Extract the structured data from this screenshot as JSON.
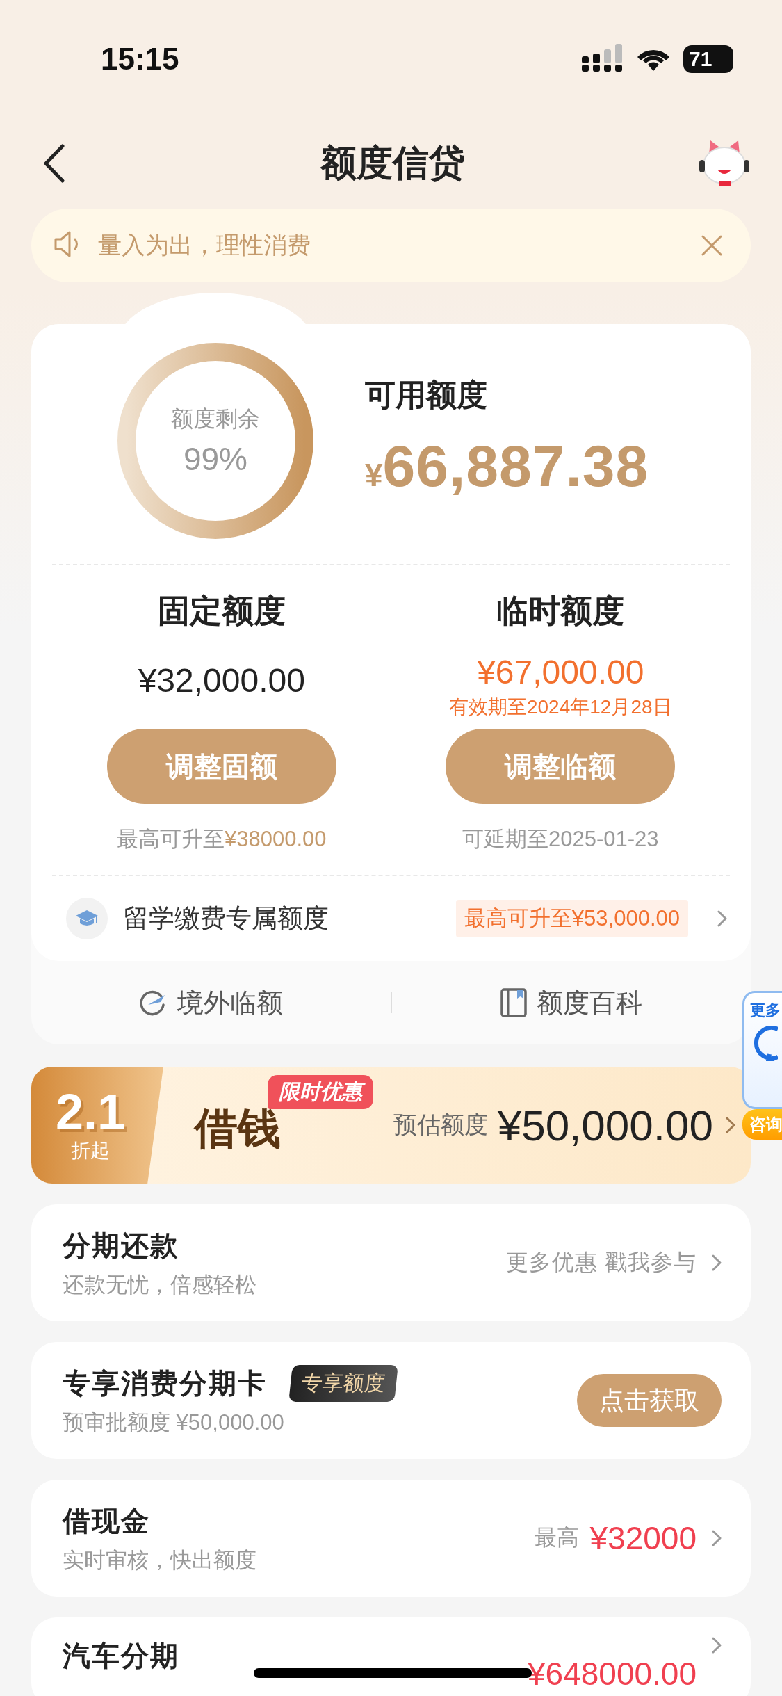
{
  "status_bar": {
    "time": "15:15",
    "battery": "71"
  },
  "nav": {
    "title": "额度信贷"
  },
  "notice": {
    "text": "量入为出，理性消费"
  },
  "quota": {
    "ring_label": "额度剩余",
    "ring_percent": "99%",
    "available_label": "可用额度",
    "available_currency": "¥",
    "available_amount": "66,887.38",
    "columns": [
      {
        "kind": "fixed",
        "title": "固定额度",
        "amount": "¥32,000.00",
        "button": "调整固额",
        "note": "最高可升至",
        "note_value": "¥38000.00"
      },
      {
        "kind": "temporary",
        "title": "临时额度",
        "amount": "¥67,000.00",
        "validity": "有效期至2024年12月28日",
        "button": "调整临额",
        "note": "可延期至2025-01-23"
      }
    ],
    "study": {
      "label": "留学缴费专属额度",
      "badge": "最高可升至¥53,000.00"
    },
    "links": [
      {
        "kind": "overseas",
        "label": "境外临额"
      },
      {
        "kind": "wiki",
        "label": "额度百科"
      }
    ]
  },
  "promo": {
    "discount": "2.1",
    "discount_suffix": "折起",
    "title": "借钱",
    "tag": "限时优惠",
    "label": "预估额度",
    "amount": "¥50,000.00"
  },
  "products": [
    {
      "kind": "link",
      "title": "分期还款",
      "subtitle": "还款无忧，倍感轻松",
      "action": "更多优惠 戳我参与"
    },
    {
      "kind": "button",
      "title": "专享消费分期卡",
      "tag": "专享额度",
      "subtitle": "预审批额度 ¥50,000.00",
      "action": "点击获取"
    },
    {
      "kind": "max",
      "title": "借现金",
      "subtitle": "实时审核，快出额度",
      "prefix": "最高",
      "action": "¥32000"
    },
    {
      "kind": "max",
      "title": "汽车分期",
      "action": "¥648000.00"
    }
  ],
  "float": {
    "top": "更多",
    "bottom": "咨询"
  }
}
